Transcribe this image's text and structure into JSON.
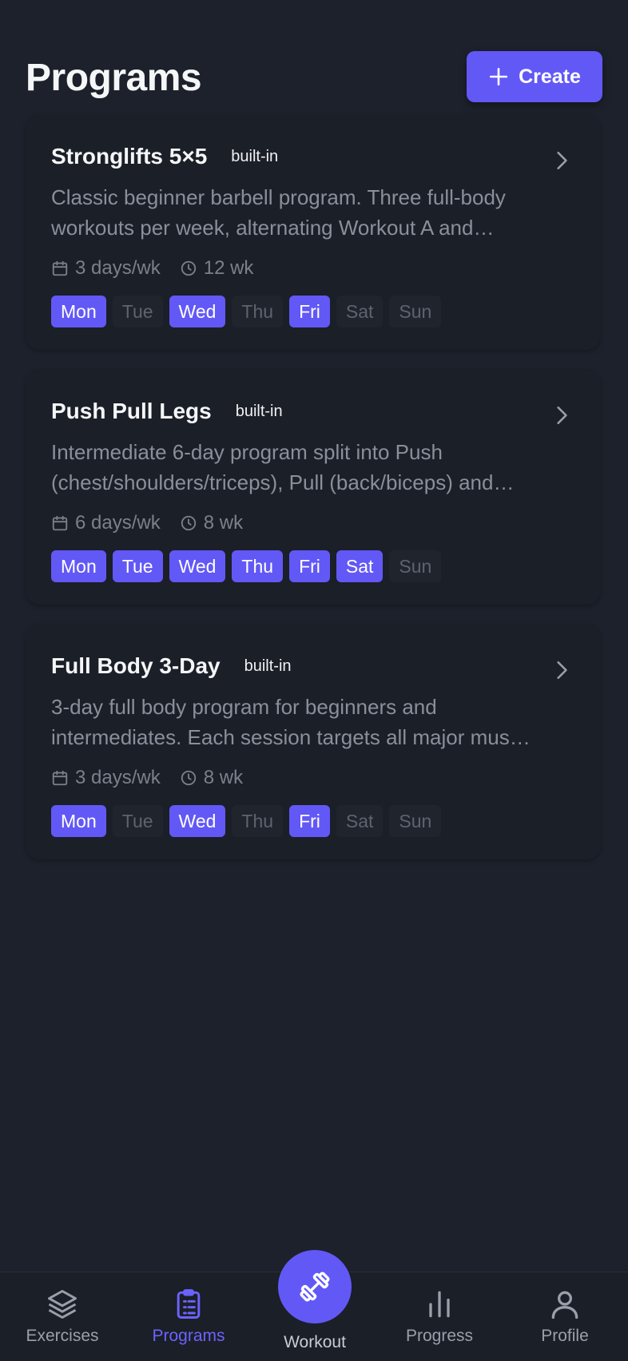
{
  "header": {
    "title": "Programs",
    "create_label": "Create"
  },
  "programs": [
    {
      "title": "Stronglifts 5×5",
      "badge": "built-in",
      "description": "Classic beginner barbell program. Three full-body workouts per week, alternating Workout A and Workout B.",
      "frequency": "3 days/wk",
      "duration": "12 wk",
      "days": [
        {
          "label": "Mon",
          "active": true
        },
        {
          "label": "Tue",
          "active": false
        },
        {
          "label": "Wed",
          "active": true
        },
        {
          "label": "Thu",
          "active": false
        },
        {
          "label": "Fri",
          "active": true
        },
        {
          "label": "Sat",
          "active": false
        },
        {
          "label": "Sun",
          "active": false
        }
      ]
    },
    {
      "title": "Push Pull Legs",
      "badge": "built-in",
      "description": "Intermediate 6-day program split into Push (chest/shoulders/triceps), Pull (back/biceps) and Legs.",
      "frequency": "6 days/wk",
      "duration": "8 wk",
      "days": [
        {
          "label": "Mon",
          "active": true
        },
        {
          "label": "Tue",
          "active": true
        },
        {
          "label": "Wed",
          "active": true
        },
        {
          "label": "Thu",
          "active": true
        },
        {
          "label": "Fri",
          "active": true
        },
        {
          "label": "Sat",
          "active": true
        },
        {
          "label": "Sun",
          "active": false
        }
      ]
    },
    {
      "title": "Full Body 3-Day",
      "badge": "built-in",
      "description": "3-day full body program for beginners and intermediates. Each session targets all major muscle groups.",
      "frequency": "3 days/wk",
      "duration": "8 wk",
      "days": [
        {
          "label": "Mon",
          "active": true
        },
        {
          "label": "Tue",
          "active": false
        },
        {
          "label": "Wed",
          "active": true
        },
        {
          "label": "Thu",
          "active": false
        },
        {
          "label": "Fri",
          "active": true
        },
        {
          "label": "Sat",
          "active": false
        },
        {
          "label": "Sun",
          "active": false
        }
      ]
    }
  ],
  "nav": {
    "exercises": "Exercises",
    "programs": "Programs",
    "workout": "Workout",
    "progress": "Progress",
    "profile": "Profile",
    "active": "programs"
  },
  "colors": {
    "accent": "#6258f6",
    "background": "#1c212b",
    "card": "#1b1f27"
  }
}
